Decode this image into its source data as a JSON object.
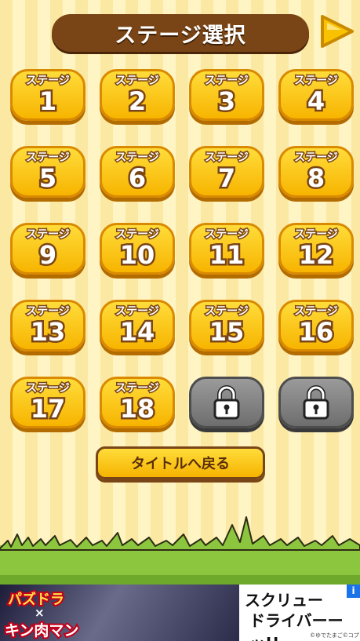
{
  "header": {
    "title": "ステージ選択"
  },
  "stage_label": "ステージ",
  "stages": [
    {
      "num": "1"
    },
    {
      "num": "2"
    },
    {
      "num": "3"
    },
    {
      "num": "4"
    },
    {
      "num": "5"
    },
    {
      "num": "6"
    },
    {
      "num": "7"
    },
    {
      "num": "8"
    },
    {
      "num": "9"
    },
    {
      "num": "10"
    },
    {
      "num": "11"
    },
    {
      "num": "12"
    },
    {
      "num": "13"
    },
    {
      "num": "14"
    },
    {
      "num": "15"
    },
    {
      "num": "16"
    },
    {
      "num": "17"
    },
    {
      "num": "18"
    }
  ],
  "locked_count": 2,
  "back_button": {
    "label": "タイトルへ戻る"
  },
  "ad": {
    "logo_top": "パズドラ",
    "logo_cross": "×",
    "logo_bottom": "キン肉マン",
    "line1": "スクリュー",
    "line2": "ドライバーーッ!!",
    "copyright": "©ゆでたまご©コプロ",
    "info": "i"
  },
  "colors": {
    "button_yellow": "#ffdc3a",
    "brown": "#7a4516",
    "locked_gray": "#8a8a8a",
    "grass_green": "#8cc63f"
  },
  "icons": {
    "next": "play-triangle-icon",
    "lock": "padlock-icon"
  }
}
